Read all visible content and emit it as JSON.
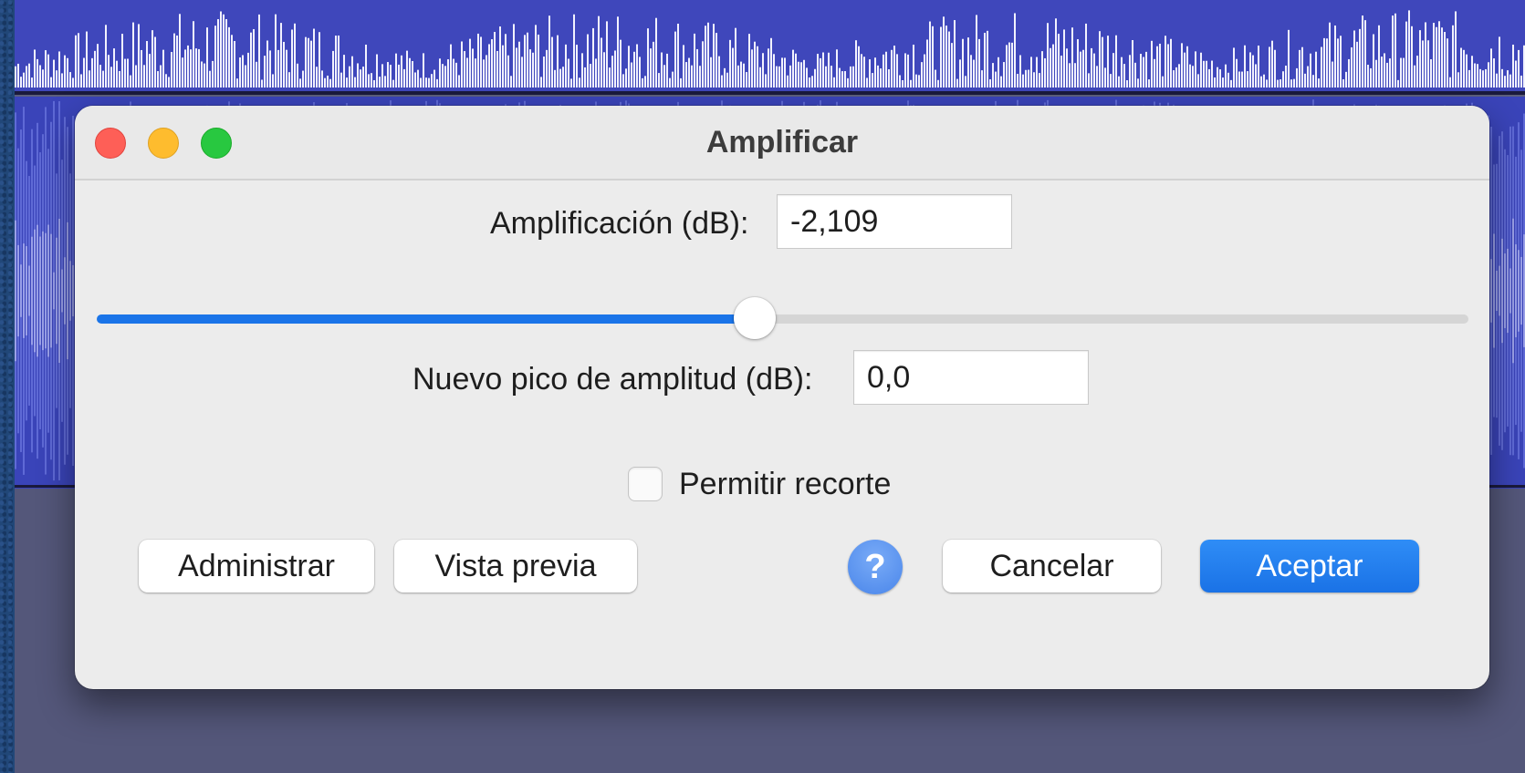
{
  "dialog": {
    "title": "Amplificar",
    "amplification_label": "Amplificación (dB):",
    "amplification_value": "-2,109",
    "slider_level_percent": 48,
    "peak_label": "Nuevo pico de amplitud (dB):",
    "peak_value": "0,0",
    "clip_label": "Permitir recorte",
    "clip_checked": false,
    "buttons": {
      "manage": "Administrar",
      "preview": "Vista previa",
      "help": "?",
      "cancel": "Cancelar",
      "ok": "Aceptar"
    }
  },
  "colors": {
    "accent": "#1a74e8",
    "waveform": "#3a44b9",
    "waveform_light": "#ffffff",
    "close": "#fe5f57",
    "minimize": "#febc2e",
    "zoom": "#28c840"
  },
  "icons": {
    "close": "close-icon",
    "minimize": "minimize-icon",
    "zoom": "zoom-icon",
    "help": "question-mark-icon"
  }
}
